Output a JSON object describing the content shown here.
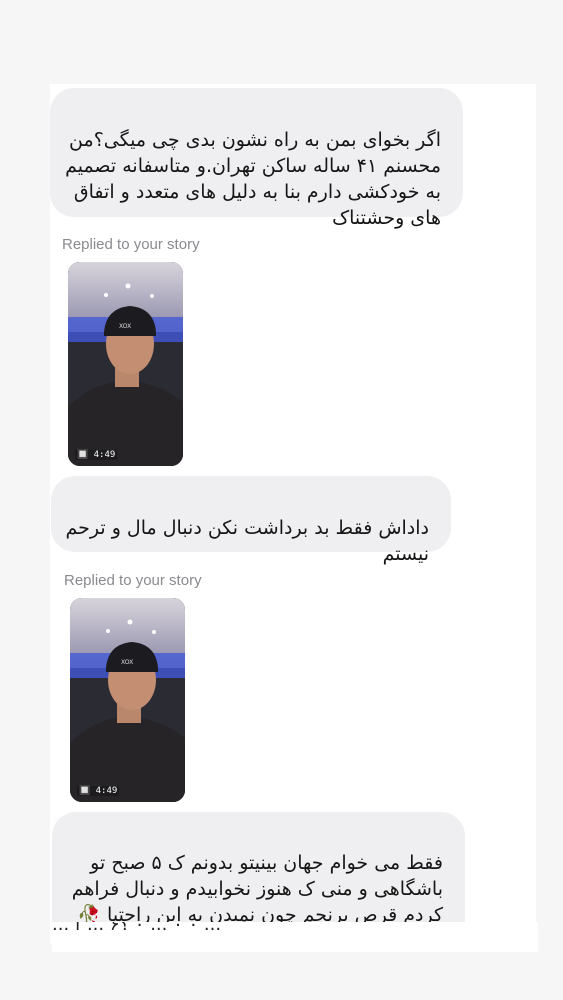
{
  "messages": [
    {
      "text": "اگر بخوای بمن به راه نشون بدی چی میگی؟من\nمحسنم ۴۱ ساله ساکن تهران.و متاسفانه تصمیم\nبه خودکشی دارم بنا به دلیل های متعدد و اتفاق\nهای وحشتناک"
    },
    {
      "text": "داداش فقط بد برداشت نکن دنبال مال و ترحم\nنیستم"
    },
    {
      "text": "فقط می خوام جهان بینیتو بدونم ک ۵ صبح تو\nباشگاهی و منی ک هنوز نخوابیدم و دنبال فراهم\nکردم قرص برنجم چون نمیدن به این راحتیا 🥀",
      "hearts": "💔💔💔"
    }
  ],
  "replies": [
    {
      "label": "Replied to your story",
      "stamp": "🔲 4:49"
    },
    {
      "label": "Replied to your story",
      "stamp": "🔲 4:49"
    }
  ],
  "cut_text": "... ۰ ۰ ... ۰ ؟۶ ... f ..."
}
